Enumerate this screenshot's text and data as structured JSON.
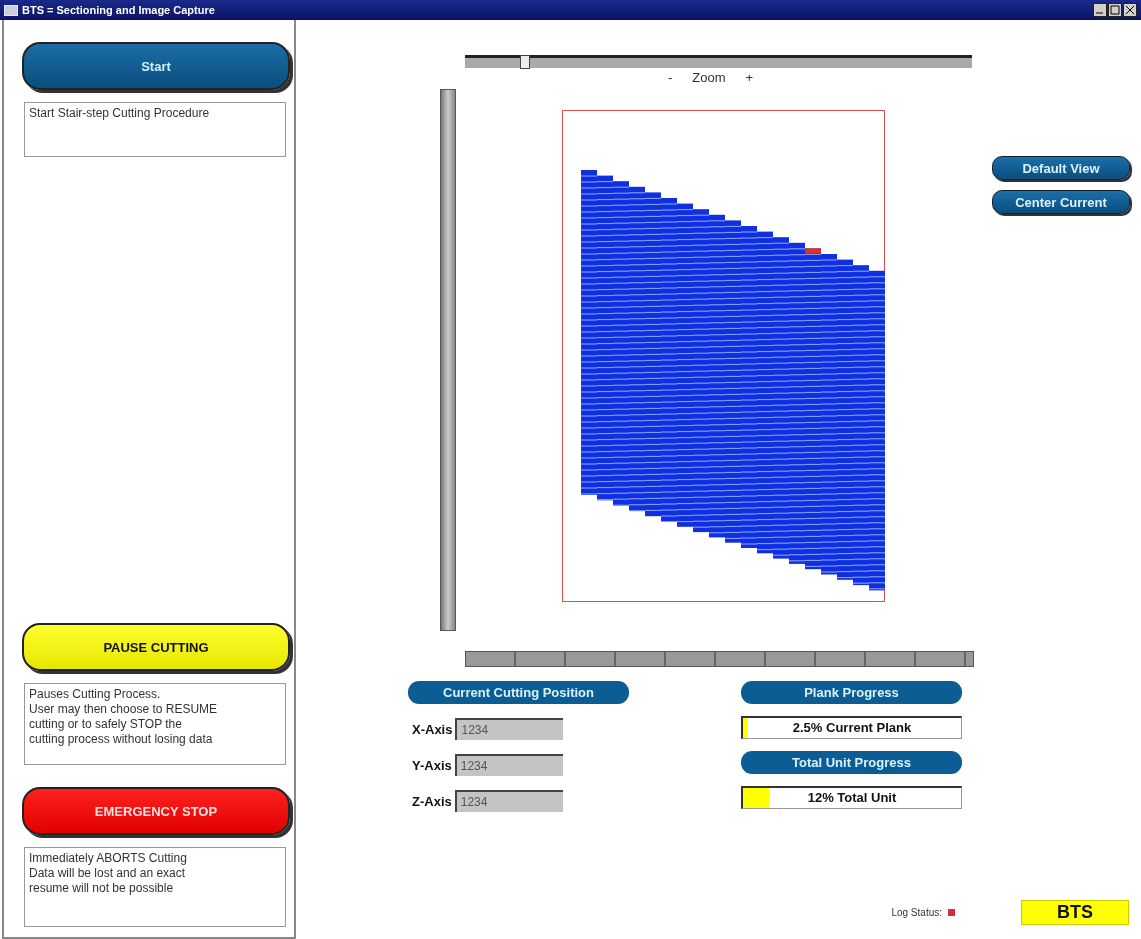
{
  "window": {
    "title": "BTS = Sectioning and Image Capture"
  },
  "controls": [
    {
      "kind": "start",
      "label": "Start",
      "description": "Start Stair-step Cutting Procedure"
    },
    {
      "kind": "pause",
      "label": "PAUSE CUTTING",
      "description": "Pauses Cutting Process.\nUser may then choose to RESUME\ncutting or to safely STOP the\ncutting process without losing data"
    },
    {
      "kind": "stop",
      "label": "EMERGENCY STOP",
      "description": "Immediately ABORTS Cutting\nData will be lost and an exact\nresume will not be possible"
    }
  ],
  "zoom": {
    "minus": "-",
    "label": "Zoom",
    "plus": "+",
    "level": 0.11
  },
  "view_buttons": [
    "Default View",
    "Center Current"
  ],
  "position": {
    "title": "Current Cutting Position",
    "axes": [
      {
        "label": "X-Axis",
        "value": "1234"
      },
      {
        "label": "Y-Axis",
        "value": "1234"
      },
      {
        "label": "Z-Axis",
        "value": "1234"
      }
    ]
  },
  "progress": [
    {
      "title": "Plank Progress",
      "text": "2.5% Current Plank",
      "level": 0.025
    },
    {
      "title": "Total Unit Progress",
      "text": "12% Total Unit",
      "level": 0.12
    }
  ],
  "footer": {
    "log_status": "Log Status:",
    "brand": "BTS"
  }
}
